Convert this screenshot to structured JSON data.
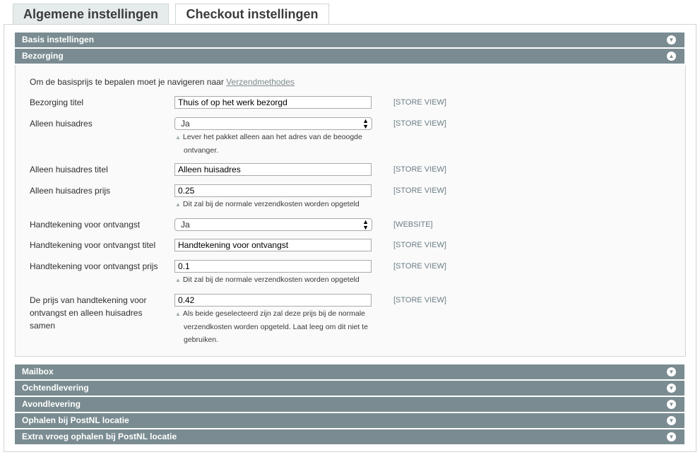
{
  "tabs": {
    "general": "Algemene instellingen",
    "checkout": "Checkout instellingen"
  },
  "sections": {
    "basis": "Basis instellingen",
    "bezorging": "Bezorging",
    "mailbox": "Mailbox",
    "ochtend": "Ochtendlevering",
    "avond": "Avondlevering",
    "ophalen": "Ophalen bij PostNL locatie",
    "extra": "Extra vroeg ophalen bij PostNL locatie"
  },
  "bezorging": {
    "intro_text": "Om de basisprijs te bepalen moet je navigeren naar",
    "intro_link": "Verzendmethodes",
    "fields": {
      "titel": {
        "label": "Bezorging titel",
        "value": "Thuis of op het werk bezorgd",
        "scope": "[STORE VIEW]"
      },
      "huisadres": {
        "label": "Alleen huisadres",
        "value": "Ja",
        "scope": "[STORE VIEW]",
        "note": "Lever het pakket alleen aan het adres van de beoogde ontvanger."
      },
      "huisadres_titel": {
        "label": "Alleen huisadres titel",
        "value": "Alleen huisadres",
        "scope": "[STORE VIEW]"
      },
      "huisadres_prijs": {
        "label": "Alleen huisadres prijs",
        "value": "0.25",
        "scope": "[STORE VIEW]",
        "note": "Dit zal bij de normale verzendkosten worden opgeteld"
      },
      "handtekening": {
        "label": "Handtekening voor ontvangst",
        "value": "Ja",
        "scope": "[WEBSITE]"
      },
      "handtekening_titel": {
        "label": "Handtekening voor ontvangst titel",
        "value": "Handtekening voor ontvangst",
        "scope": "[STORE VIEW]"
      },
      "handtekening_prijs": {
        "label": "Handtekening voor ontvangst prijs",
        "value": "0.1",
        "scope": "[STORE VIEW]",
        "note": "Dit zal bij de normale verzendkosten worden opgeteld"
      },
      "combi_prijs": {
        "label": "De prijs van handtekening voor ontvangst en alleen huisadres samen",
        "value": "0.42",
        "scope": "[STORE VIEW]",
        "note": "Als beide geselecteerd zijn zal deze prijs bij de normale verzendkosten worden opgeteld. Laat leeg om dit niet te gebruiken."
      }
    }
  },
  "colors": {
    "header_bg": "#7a8c91",
    "panel_border": "#cfd6d6"
  },
  "icons": {
    "collapsed": "chevron-down-icon",
    "expanded": "chevron-up-icon"
  }
}
